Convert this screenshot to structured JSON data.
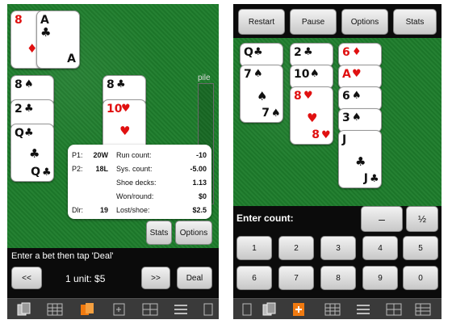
{
  "left": {
    "dealer_cards": [
      {
        "rank": "8",
        "suit": "♦",
        "color": "red"
      },
      {
        "rank": "A",
        "suit": "♣",
        "color": "black"
      }
    ],
    "hand1_cards": [
      {
        "rank": "8",
        "suit": "♠",
        "color": "black"
      },
      {
        "rank": "2",
        "suit": "♣",
        "color": "black"
      },
      {
        "rank": "Q",
        "suit": "♣",
        "color": "black"
      }
    ],
    "hand2_cards": [
      {
        "rank": "8",
        "suit": "♣",
        "color": "black"
      },
      {
        "rank": "10",
        "suit": "♥",
        "color": "red"
      }
    ],
    "pile_label": "pile",
    "stats_panel": {
      "p1_label": "P1:",
      "p1_value": "20W",
      "p2_label": "P2:",
      "p2_value": "18L",
      "dlr_label": "Dlr:",
      "dlr_value": "19",
      "run_count_label": "Run count:",
      "run_count_value": "-10",
      "sys_count_label": "Sys. count:",
      "sys_count_value": "-5.00",
      "shoe_decks_label": "Shoe decks:",
      "shoe_decks_value": "1.13",
      "won_round_label": "Won/round:",
      "won_round_value": "$0",
      "lost_shoe_label": "Lost/shoe:",
      "lost_shoe_value": "$2.5"
    },
    "stats_button": "Stats",
    "options_button": "Options",
    "prompt": "Enter a bet then tap 'Deal'",
    "decrease_button": "<<",
    "bet_display": "1 unit: $5",
    "increase_button": ">>",
    "deal_button": "Deal"
  },
  "right": {
    "top_buttons": [
      "Restart",
      "Pause",
      "Options",
      "Stats"
    ],
    "column1": [
      {
        "rank": "Q",
        "suit": "♣",
        "color": "black"
      },
      {
        "rank": "7",
        "suit": "♠",
        "color": "black"
      }
    ],
    "column2": [
      {
        "rank": "2",
        "suit": "♣",
        "color": "black"
      },
      {
        "rank": "10",
        "suit": "♠",
        "color": "black"
      },
      {
        "rank": "8",
        "suit": "♥",
        "color": "red"
      }
    ],
    "column3": [
      {
        "rank": "6",
        "suit": "♦",
        "color": "red"
      },
      {
        "rank": "A",
        "suit": "♥",
        "color": "red"
      },
      {
        "rank": "6",
        "suit": "♠",
        "color": "black"
      },
      {
        "rank": "3",
        "suit": "♠",
        "color": "black"
      },
      {
        "rank": "J",
        "suit": "♣",
        "color": "black"
      }
    ],
    "prompt": "Enter count:",
    "minus_button": "–",
    "half_button": "½",
    "keypad": [
      "1",
      "2",
      "3",
      "4",
      "5",
      "6",
      "7",
      "8",
      "9",
      "0"
    ]
  },
  "colors": {
    "felt": "#1e7d2c",
    "accent_orange": "#f07a10"
  },
  "toolbar_icons": [
    "cards-icon",
    "grid-icon",
    "active-cards-icon",
    "deck-icon",
    "table-icon",
    "list-icon",
    "hand-icon"
  ]
}
